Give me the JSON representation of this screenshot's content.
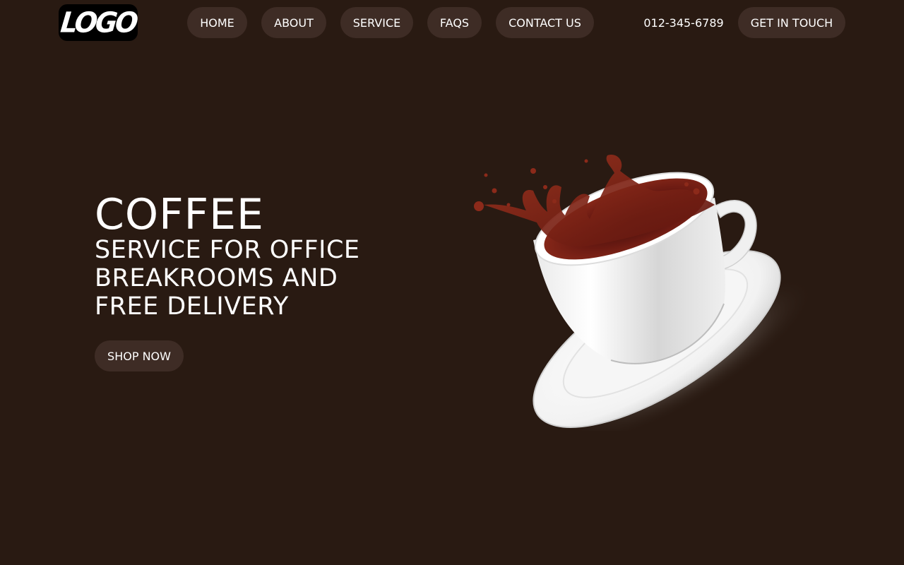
{
  "header": {
    "logo_text": "LOGO",
    "nav": [
      {
        "label": "HOME"
      },
      {
        "label": "ABOUT"
      },
      {
        "label": "SERVICE"
      },
      {
        "label": "FAQS"
      },
      {
        "label": "CONTACT US"
      }
    ],
    "phone": "012-345-6789",
    "cta_label": "GET IN TOUCH"
  },
  "hero": {
    "title": "COFFEE",
    "subtitle": "SERVICE FOR OFFICE BREAKROOMS AND FREE DELIVERY",
    "button_label": "SHOP NOW"
  },
  "colors": {
    "background": "#291a12",
    "pill": "#3e2c25",
    "text": "#ffffff",
    "coffee": "#7a1c12"
  },
  "icons": {
    "hero_image": "coffee-cup-splash-illustration"
  }
}
